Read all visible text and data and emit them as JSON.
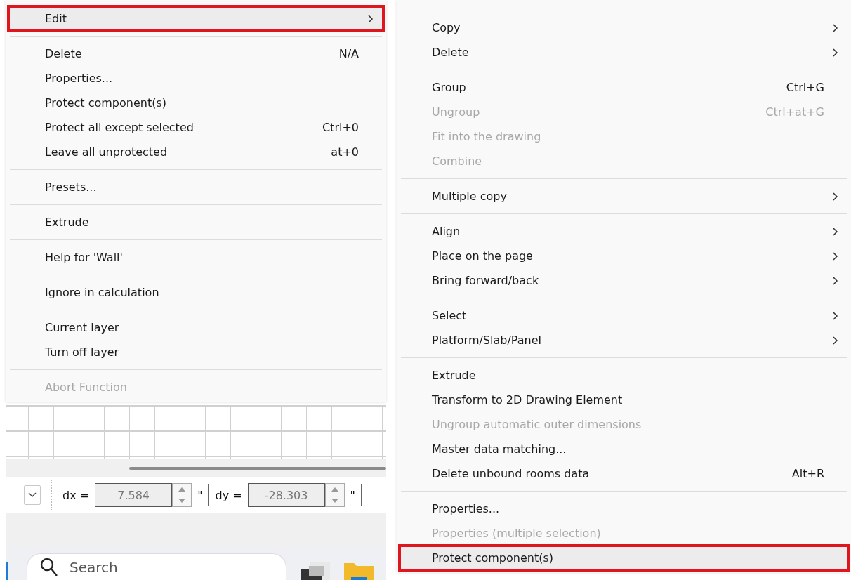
{
  "left_menu": {
    "sections": [
      [
        {
          "label": "Edit",
          "submenu": true,
          "disabled": false,
          "selected": true
        }
      ],
      [
        {
          "label": "Delete",
          "shortcut": "N/A",
          "submenu": false,
          "disabled": false,
          "selected": false
        },
        {
          "label": "Properties...",
          "submenu": false,
          "disabled": false,
          "selected": false
        },
        {
          "label": "Protect component(s)",
          "submenu": false,
          "disabled": false,
          "selected": false
        },
        {
          "label": "Protect all except selected",
          "shortcut": "Ctrl+0",
          "submenu": false,
          "disabled": false,
          "selected": false
        },
        {
          "label": "Leave all unprotected",
          "shortcut": "at+0",
          "submenu": false,
          "disabled": false,
          "selected": false
        }
      ],
      [
        {
          "label": "Presets...",
          "submenu": false,
          "disabled": false,
          "selected": false
        }
      ],
      [
        {
          "label": "Extrude",
          "submenu": false,
          "disabled": false,
          "selected": false
        }
      ],
      [
        {
          "label": "Help for 'Wall'",
          "submenu": false,
          "disabled": false,
          "selected": false
        }
      ],
      [
        {
          "label": "Ignore in calculation",
          "submenu": false,
          "disabled": false,
          "selected": false
        }
      ],
      [
        {
          "label": "Current layer",
          "submenu": false,
          "disabled": false,
          "selected": false
        },
        {
          "label": "Turn off layer",
          "submenu": false,
          "disabled": false,
          "selected": false
        }
      ],
      [
        {
          "label": "Abort Function",
          "submenu": false,
          "disabled": true,
          "selected": false
        }
      ]
    ]
  },
  "toolbar": {
    "dx_label": "dx =",
    "dx_value": "7.584",
    "dx_unit": "\"",
    "dy_label": "dy =",
    "dy_value": "-28.303",
    "dy_unit": "\""
  },
  "taskbar": {
    "search": {
      "placeholder": "Search"
    }
  },
  "right_menu": {
    "sections": [
      [
        {
          "label": "Copy",
          "submenu": true,
          "disabled": false,
          "selected": false
        },
        {
          "label": "Delete",
          "submenu": true,
          "disabled": false,
          "selected": false
        }
      ],
      [
        {
          "label": "Group",
          "shortcut": "Ctrl+G",
          "submenu": false,
          "disabled": false,
          "selected": false
        },
        {
          "label": "Ungroup",
          "shortcut": "Ctrl+at+G",
          "submenu": false,
          "disabled": true,
          "selected": false
        },
        {
          "label": "Fit into the drawing",
          "submenu": false,
          "disabled": true,
          "selected": false
        },
        {
          "label": "Combine",
          "submenu": false,
          "disabled": true,
          "selected": false
        }
      ],
      [
        {
          "label": "Multiple copy",
          "submenu": true,
          "disabled": false,
          "selected": false
        }
      ],
      [
        {
          "label": "Align",
          "submenu": true,
          "disabled": false,
          "selected": false
        },
        {
          "label": "Place on the page",
          "submenu": true,
          "disabled": false,
          "selected": false
        },
        {
          "label": "Bring forward/back",
          "submenu": true,
          "disabled": false,
          "selected": false
        }
      ],
      [
        {
          "label": "Select",
          "submenu": true,
          "disabled": false,
          "selected": false
        },
        {
          "label": "Platform/Slab/Panel",
          "submenu": true,
          "disabled": false,
          "selected": false
        }
      ],
      [
        {
          "label": "Extrude",
          "submenu": false,
          "disabled": false,
          "selected": false
        },
        {
          "label": "Transform to 2D Drawing Element",
          "submenu": false,
          "disabled": false,
          "selected": false
        },
        {
          "label": "Ungroup automatic outer dimensions",
          "submenu": false,
          "disabled": true,
          "selected": false
        },
        {
          "label": "Master data matching...",
          "submenu": false,
          "disabled": false,
          "selected": false
        },
        {
          "label": "Delete unbound rooms data",
          "shortcut": "Alt+R",
          "submenu": false,
          "disabled": false,
          "selected": false
        }
      ],
      [
        {
          "label": "Properties...",
          "submenu": false,
          "disabled": false,
          "selected": false
        },
        {
          "label": "Properties (multiple selection)",
          "submenu": false,
          "disabled": true,
          "selected": false
        },
        {
          "label": "Protect component(s)",
          "submenu": false,
          "disabled": false,
          "selected": true
        }
      ]
    ]
  }
}
